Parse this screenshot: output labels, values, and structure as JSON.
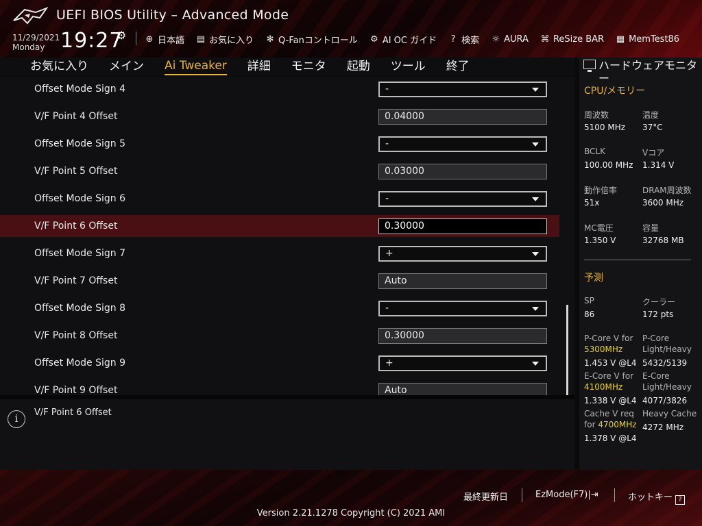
{
  "header": {
    "title": "UEFI BIOS Utility – Advanced Mode",
    "date": "11/29/2021",
    "weekday": "Monday",
    "time": "19:27",
    "toolbar": [
      {
        "icon": "globe-icon",
        "glyph": "⊕",
        "label": "日本語"
      },
      {
        "icon": "favorites-icon",
        "glyph": "▤",
        "label": "お気に入り"
      },
      {
        "icon": "fan-icon",
        "glyph": "✻",
        "label": "Q-Fanコントロール"
      },
      {
        "icon": "ai-oc-icon",
        "glyph": "⚙",
        "label": "AI OC ガイド"
      },
      {
        "icon": "search-icon",
        "glyph": "?",
        "label": "検索"
      },
      {
        "icon": "aura-icon",
        "glyph": "☼",
        "label": "AURA"
      },
      {
        "icon": "resize-bar-icon",
        "glyph": "⌘",
        "label": "ReSize BAR"
      },
      {
        "icon": "memtest-icon",
        "glyph": "▦",
        "label": "MemTest86"
      }
    ]
  },
  "tabs": [
    {
      "label": "お気に入り",
      "active": false
    },
    {
      "label": "メイン",
      "active": false
    },
    {
      "label": "Ai Tweaker",
      "active": true
    },
    {
      "label": "詳細",
      "active": false
    },
    {
      "label": "モニタ",
      "active": false
    },
    {
      "label": "起動",
      "active": false
    },
    {
      "label": "ツール",
      "active": false
    },
    {
      "label": "終了",
      "active": false
    }
  ],
  "settings": [
    {
      "label": "Offset Mode Sign 4",
      "kind": "dropdown",
      "value": "-"
    },
    {
      "label": "V/F Point 4 Offset",
      "kind": "field",
      "value": "0.04000"
    },
    {
      "label": "Offset Mode Sign 5",
      "kind": "dropdown",
      "value": "-"
    },
    {
      "label": "V/F Point 5 Offset",
      "kind": "field",
      "value": "0.03000"
    },
    {
      "label": "Offset Mode Sign 6",
      "kind": "dropdown",
      "value": "-"
    },
    {
      "label": "V/F Point 6 Offset",
      "kind": "field",
      "value": "0.30000",
      "selected": true
    },
    {
      "label": "Offset Mode Sign 7",
      "kind": "dropdown",
      "value": "+"
    },
    {
      "label": "V/F Point 7 Offset",
      "kind": "field",
      "value": "Auto"
    },
    {
      "label": "Offset Mode Sign 8",
      "kind": "dropdown",
      "value": "-"
    },
    {
      "label": "V/F Point 8 Offset",
      "kind": "field",
      "value": "0.30000"
    },
    {
      "label": "Offset Mode Sign 9",
      "kind": "dropdown",
      "value": "+"
    },
    {
      "label": "V/F Point 9 Offset",
      "kind": "field",
      "value": "Auto"
    }
  ],
  "help": {
    "text": "V/F Point 6 Offset"
  },
  "monitor": {
    "title": "ハードウェアモニター",
    "cpu_section": "CPU/メモリー",
    "freq_label": "周波数",
    "freq_value": "5100 MHz",
    "temp_label": "温度",
    "temp_value": "37°C",
    "bclk_label": "BCLK",
    "bclk_value": "100.00 MHz",
    "vcore_label": "Vコア",
    "vcore_value": "1.314 V",
    "ratio_label": "動作倍率",
    "ratio_value": "51x",
    "dram_label": "DRAM周波数",
    "dram_value": "3600 MHz",
    "mc_label": "MC電圧",
    "mc_value": "1.350 V",
    "cap_label": "容量",
    "cap_value": "32768 MB",
    "predict_section": "予測",
    "sp_label": "SP",
    "sp_value": "86",
    "cooler_label": "クーラー",
    "cooler_value": "172 pts",
    "pcore_v_label": "P-Core V for",
    "pcore_v_freq": "5300MHz",
    "pcore_v_value": "1.453 V @L4",
    "pcore_lh_label1": "P-Core",
    "pcore_lh_label2": "Light/Heavy",
    "pcore_lh_value": "5432/5139",
    "ecore_v_label": "E-Core V for",
    "ecore_v_freq": "4100MHz",
    "ecore_v_value": "1.338 V @L4",
    "ecore_lh_label1": "E-Core",
    "ecore_lh_label2": "Light/Heavy",
    "ecore_lh_value": "4077/3826",
    "cache_v_label1": "Cache V req",
    "cache_v_label2": "for",
    "cache_v_freq": "4700MHz",
    "cache_v_value": "1.378 V @L4",
    "heavy_cache_label": "Heavy Cache",
    "heavy_cache_value": "4272 MHz"
  },
  "footer": {
    "last_modified": "最終更新日",
    "ezmode": "EzMode(F7)|",
    "hotkeys": "ホットキー",
    "version": "Version 2.21.1278 Copyright (C) 2021 AMI"
  }
}
